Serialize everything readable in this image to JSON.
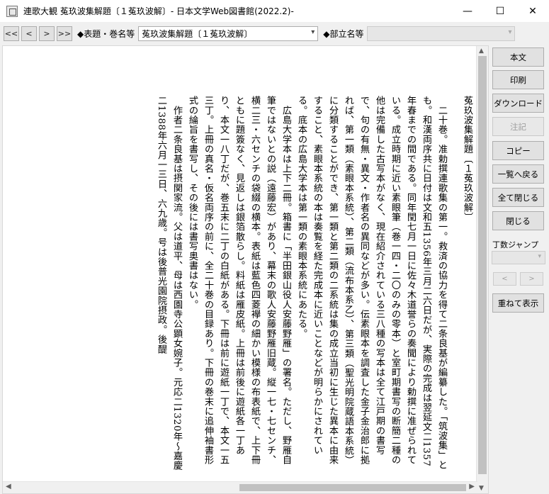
{
  "window": {
    "title": "連歌大観 菟玖波集解題〔１菟玖波解〕- 日本文学Web図書館(2022.2)-",
    "minimize": "—",
    "maximize": "☐",
    "close": "✕"
  },
  "toolbar": {
    "first": "<<",
    "prev": "<",
    "next": ">",
    "last": ">>",
    "label_title": "◆表題・巻名等",
    "title_select_value": "菟玖波集解題〔１菟玖波解〕",
    "label_part": "◆部立名等",
    "part_select_value": ""
  },
  "document": {
    "heading": "菟玖波集解題〔１菟玖波解〕",
    "paragraphs": [
      "　二十巻。准勅撰連歌集の第一。救済の協力を得て二条良基が編纂した。「筑波集」とも。和漢両序共に日付は文和五1356年三月二六日だが、実際の完成は翌延文二1357年春までの間である。同年閏七月一日に佐々木道誉らの奏聞により勅撰に准ぜられている。成立時期に近い素眼筆（巻一四・二〇のみの零本）と室町期書写の断簡二種の他は完備した古写本がなく、現在紹介されている三八種の写本は全て江戸期の書写で、句の有無・異文・作者名の異同などが多い。伝素眼本を調査した金子金治郎に拠れば、第一類（素眼本系統）、第二類（流布本系乙）、第三類（聖光明院蔵語本系統）に分類することができ、第一類と第二類の二系統は集の成立当初に生じた異本に由来すること、素眼本系統の本は奏覧を経た完成本に近いことなどが明らかにされている。底本の広島大学本は第一類の素眼本系統にあたる。",
      "　広島大学本は上下二冊。箱書に「半田銀山役人安藤野雁」の署名。ただし、野雁自筆ではないとの説（遠藤宏）があり、幕末の歌人安藤野雁旧蔵。縦一七・七センチ、横二三・六センチの袋綴の横本。表紙は藍色四菱襷の細かい模様の布表紙で、上下冊ともに題簽なく、見返しは銀箔散らし。料紙は雁皮紙。上冊は前後に遊紙各一丁あり、本文一八丁だが、巻五末に二丁の白紙がある。下冊は前に遊紙一丁で、本文一五三丁。上冊の真名・仮名両序の前に、全二十巻の目録あり。下冊の巻末に追伸袖書形式の綸旨を書写し、その後には書写奥書はない。",
      "　作者二条良基は摂関家流。父は道平、母は西園寺公顕女婉子。元応二1320年～嘉慶二1388年六月一三日、六九歳。号は後普光園院摂政。後醍"
    ]
  },
  "side_panel": {
    "honbun": "本文",
    "print": "印刷",
    "download": "ダウンロード",
    "note": "注記",
    "copy": "コピー",
    "back_to_list": "一覧へ戻る",
    "close_all": "全て閉じる",
    "close": "閉じる",
    "jump_label": "丁数ジャンプ",
    "jump_prev": "<",
    "jump_next": ">",
    "overlay": "重ねて表示"
  }
}
